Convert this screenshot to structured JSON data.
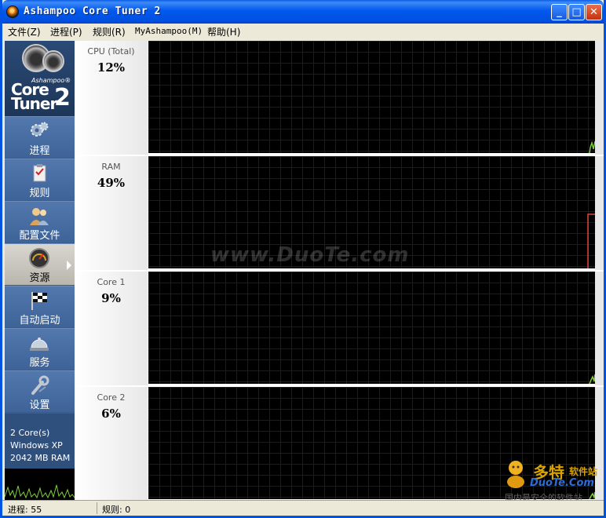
{
  "window": {
    "title": "Ashampoo Core Tuner 2",
    "controls": {
      "minimize": "_",
      "maximize": "□",
      "close": "✕"
    }
  },
  "menu": [
    "文件(Z)",
    "进程(P)",
    "规则(R)",
    "MyAshampoo(M)",
    "帮助(H)"
  ],
  "logo": {
    "brand": "Ashampoo®",
    "line1": "Core",
    "line2": "Tuner",
    "version": "2"
  },
  "sidebar": {
    "items": [
      {
        "label": "进程",
        "icon": "gears-icon",
        "active": false
      },
      {
        "label": "规则",
        "icon": "clipboard-icon",
        "active": false
      },
      {
        "label": "配置文件",
        "icon": "users-icon",
        "active": false
      },
      {
        "label": "资源",
        "icon": "gauge-icon",
        "active": true
      },
      {
        "label": "自动启动",
        "icon": "checkered-flag-icon",
        "active": false
      },
      {
        "label": "服务",
        "icon": "service-bell-icon",
        "active": false
      },
      {
        "label": "设置",
        "icon": "wrench-icon",
        "active": false
      }
    ],
    "sysinfo": [
      "2 Core(s)",
      "Windows XP",
      "2042 MB RAM"
    ]
  },
  "panels": [
    {
      "label": "CPU (Total)",
      "value": "12%",
      "level": 0.12,
      "line_color": "#7fd13b"
    },
    {
      "label": "RAM",
      "value": "49%",
      "level": 0.49,
      "line_color": "#e0443a"
    },
    {
      "label": "Core 1",
      "value": "9%",
      "level": 0.09,
      "line_color": "#7fd13b"
    },
    {
      "label": "Core 2",
      "value": "6%",
      "level": 0.06,
      "line_color": "#7fd13b"
    }
  ],
  "watermark": "www.DuoTe.com",
  "corner_logo": {
    "name": "多特",
    "suffix": "软件站",
    "url": "DuoTe.Com",
    "slogan": "国内最安全的软件站"
  },
  "status": {
    "processes": "进程:  55",
    "rules": "规则:  0"
  }
}
